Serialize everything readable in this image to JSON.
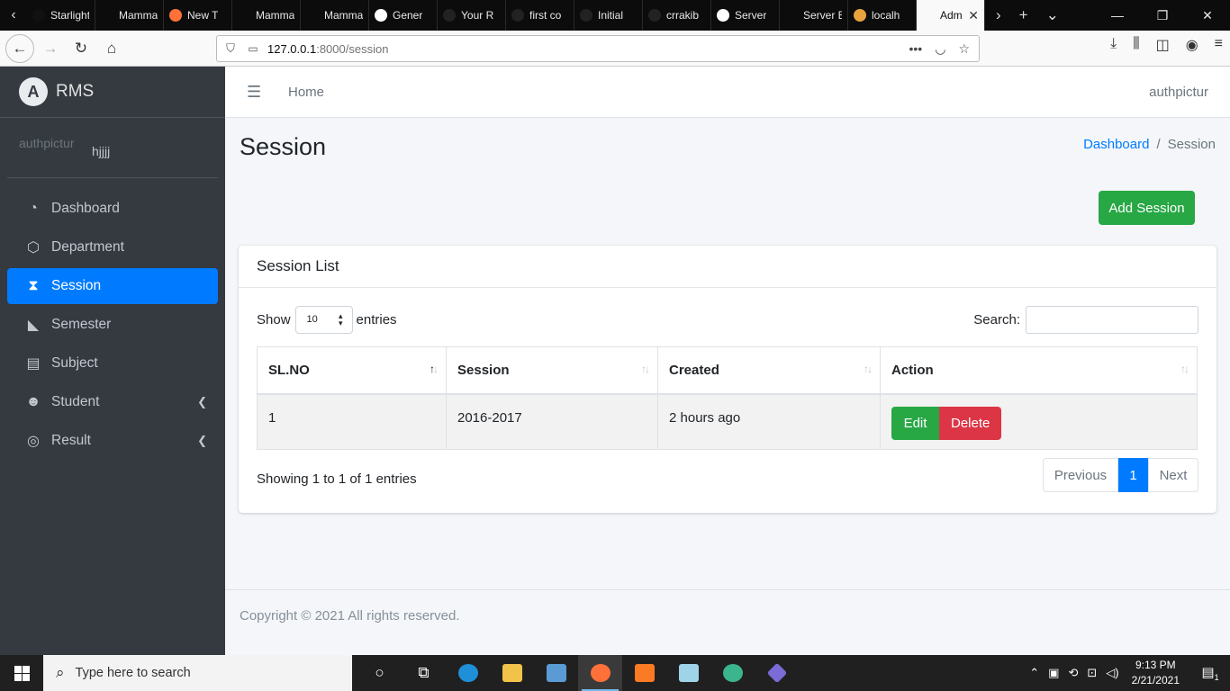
{
  "browser": {
    "tabs": [
      {
        "label": "Starlight R",
        "icon_color": "#111111"
      },
      {
        "label": "Mamma's",
        "icon_color": "#0c0c0d"
      },
      {
        "label": "New T",
        "icon_color": "#ff7139"
      },
      {
        "label": "Mamma's",
        "icon_color": "#0c0c0d"
      },
      {
        "label": "Mamma's",
        "icon_color": "#0c0c0d"
      },
      {
        "label": "Gener",
        "icon_color": "#ffffff"
      },
      {
        "label": "Your R",
        "icon_color": "#222222"
      },
      {
        "label": "first co",
        "icon_color": "#222222"
      },
      {
        "label": "Initial",
        "icon_color": "#222222"
      },
      {
        "label": "crrakib",
        "icon_color": "#222222"
      },
      {
        "label": "Server",
        "icon_color": "#ffffff"
      },
      {
        "label": "Server Erro",
        "icon_color": "#0c0c0d"
      },
      {
        "label": "localh",
        "icon_color": "#e8a33d"
      },
      {
        "label": "Admin",
        "icon_color": "#f9f9fa"
      }
    ],
    "url_host": "127.0.0.1",
    "url_path": ":8000/session"
  },
  "sidebar": {
    "brand": "RMS",
    "brand_logo_letter": "A",
    "user_image_alt": "authpictur",
    "user_name": "hjjjj",
    "items": [
      {
        "label": "Dashboard",
        "icon": "tachometer-icon",
        "glyph": "◔"
      },
      {
        "label": "Department",
        "icon": "codepen-icon",
        "glyph": "⬡"
      },
      {
        "label": "Session",
        "icon": "hourglass-icon",
        "glyph": "⧗"
      },
      {
        "label": "Semester",
        "icon": "paper-plane-icon",
        "glyph": "◣"
      },
      {
        "label": "Subject",
        "icon": "book-icon",
        "glyph": "▤"
      },
      {
        "label": "Student",
        "icon": "users-icon",
        "glyph": "☻"
      },
      {
        "label": "Result",
        "icon": "result-icon",
        "glyph": "◎"
      }
    ],
    "active_index": 2
  },
  "header": {
    "home": "Home",
    "user": "authpictur"
  },
  "page": {
    "title": "Session",
    "breadcrumb": {
      "link": "Dashboard",
      "sep": "/",
      "current": "Session"
    },
    "add_button": "Add Session"
  },
  "card": {
    "title": "Session List",
    "show_label": "Show",
    "entries_value": "10",
    "entries_label": "entries",
    "search_label": "Search:",
    "search_value": "",
    "columns": [
      "SL.NO",
      "Session",
      "Created",
      "Action"
    ],
    "rows": [
      {
        "sl": "1",
        "session": "2016-2017",
        "created": "2 hours ago",
        "edit": "Edit",
        "delete": "Delete"
      }
    ],
    "info": "Showing 1 to 1 of 1 entries",
    "pagination": {
      "prev": "Previous",
      "current": "1",
      "next": "Next"
    }
  },
  "footer": {
    "text": "Copyright © 2021 All rights reserved."
  },
  "taskbar": {
    "search_placeholder": "Type here to search",
    "time": "9:13 PM",
    "date": "2/21/2021",
    "notification_count": "1"
  },
  "colors": {
    "primary": "#007bff",
    "success": "#28a745",
    "danger": "#dc3545",
    "sidebar": "#343a40"
  }
}
